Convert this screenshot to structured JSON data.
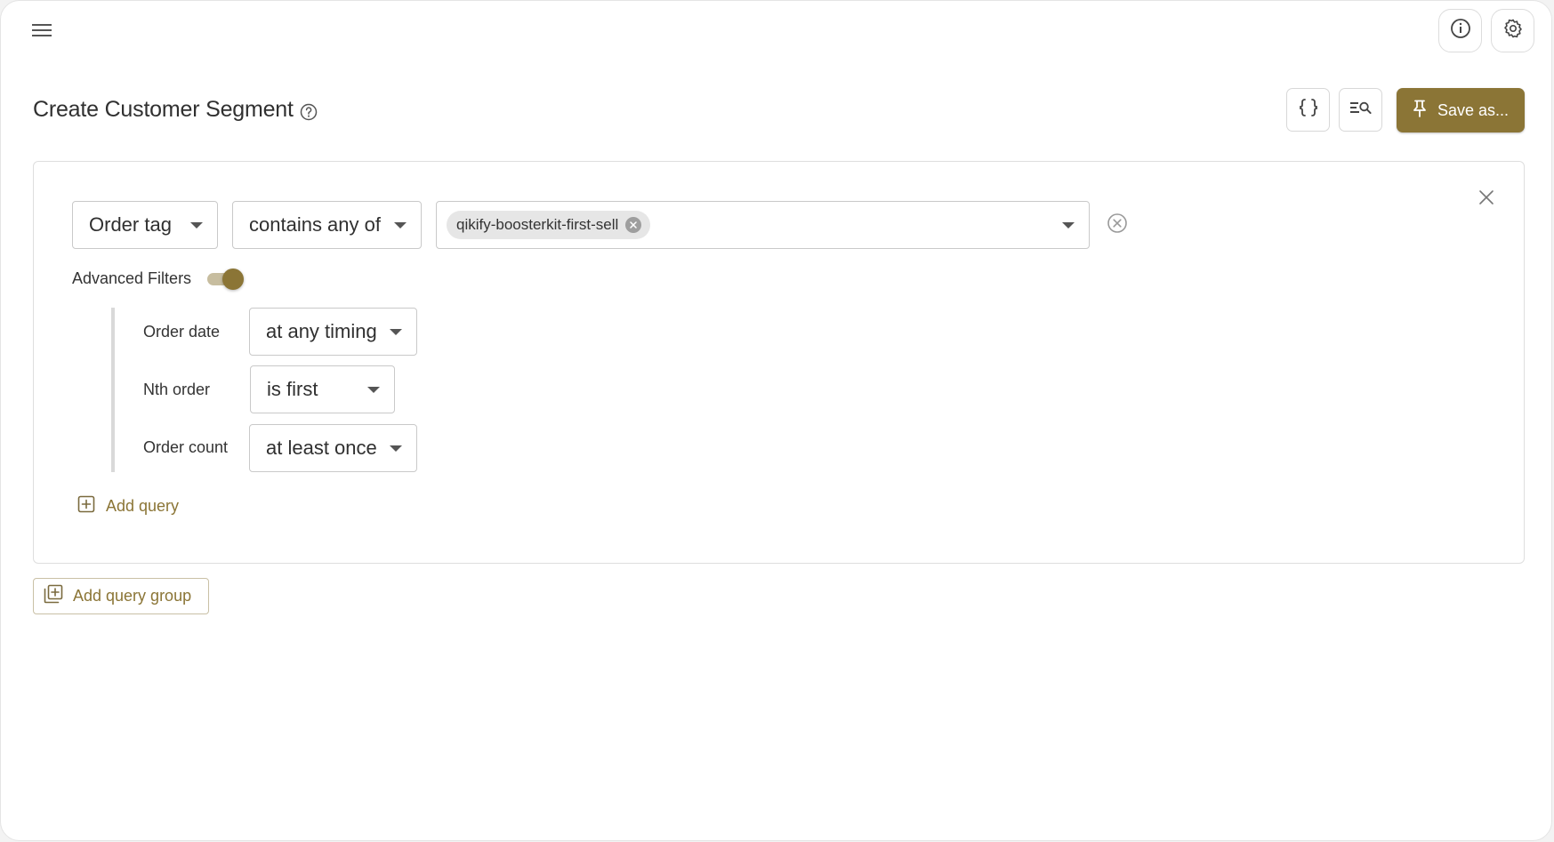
{
  "topbar": {
    "menu_icon": "hamburger-menu-icon",
    "info_icon": "info-icon",
    "settings_icon": "gear-icon"
  },
  "header": {
    "title": "Create Customer Segment",
    "help_icon": "help-circle-icon",
    "code_button_icon": "curly-braces-icon",
    "search_list_button_icon": "list-search-icon",
    "save_label": "Save as...",
    "save_icon": "pin-icon"
  },
  "query_group": {
    "field_select": "Order tag",
    "operator_select": "contains any of",
    "tags": [
      "qikify-boosterkit-first-sell"
    ],
    "advanced_filters_label": "Advanced Filters",
    "advanced_filters_enabled": true,
    "advanced_filters": [
      {
        "label": "Order date",
        "value": "at any timing"
      },
      {
        "label": "Nth order",
        "value": "is first"
      },
      {
        "label": "Order count",
        "value": "at least once"
      }
    ],
    "add_query_label": "Add query"
  },
  "add_query_group_label": "Add query group",
  "colors": {
    "accent": "#8b7536",
    "border": "#c9c9c9",
    "chip_bg": "#e6e6e6"
  }
}
